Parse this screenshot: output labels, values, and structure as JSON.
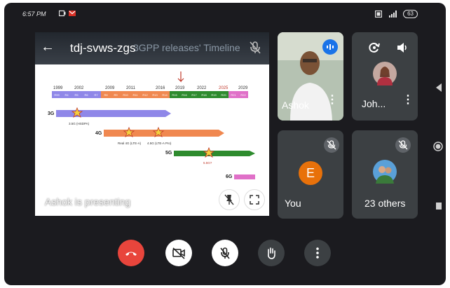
{
  "status_bar": {
    "time": "6:57 PM",
    "battery": "63"
  },
  "presentation": {
    "meeting_code": "tdj-svws-zgs",
    "slide_title_ghost": "3GPP releases' Timeline",
    "presenting_label": "Ashok is presenting",
    "years": [
      "1999",
      "2002",
      "2009",
      "2011",
      "2016",
      "2019",
      "2022",
      "2025",
      "2029"
    ],
    "releases": [
      "R99",
      "R4",
      "R5",
      "R6",
      "R7",
      "R8",
      "R9",
      "R10",
      "R11",
      "R12",
      "R13",
      "R14",
      "R15",
      "R16",
      "R17",
      "R18",
      "R19",
      "R20",
      "R21",
      "R22"
    ],
    "gens": [
      "3G",
      "4G",
      "5G",
      "6G"
    ],
    "annotations": [
      "3.5G (HSDPA)",
      "Real 4G (LTE-A)",
      "4.5G (LTE-A Pro)",
      "5.5G?"
    ]
  },
  "participants": {
    "ashok": {
      "name": "Ashok"
    },
    "john": {
      "name": "Joh..."
    },
    "you": {
      "name": "You",
      "initial": "E"
    },
    "others": {
      "label": "23 others"
    }
  },
  "colors": {
    "end_call": "#e8453c",
    "ctrl_white": "#ffffff",
    "ctrl_dark": "#3c4043",
    "tile_bg": "#3c4043",
    "gen3g": "#8f87e8",
    "gen4g": "#f08850",
    "gen5g": "#2e8b2e",
    "gen6g": "#e070c8"
  }
}
